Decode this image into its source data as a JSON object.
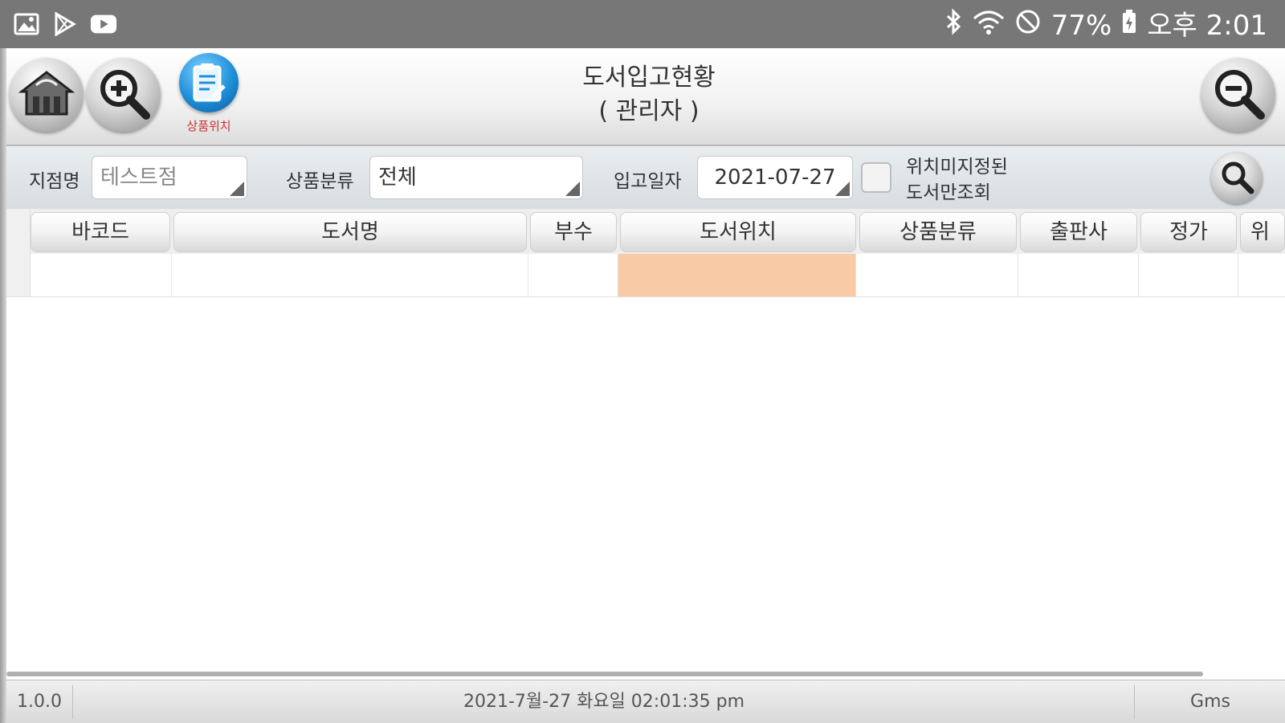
{
  "statusbar": {
    "left_icons": [
      "gallery-icon",
      "play-store-icon",
      "youtube-icon"
    ],
    "battery": "77%",
    "time": "오후 2:01"
  },
  "header": {
    "title_line1": "도서입고현황",
    "title_line2": "( 관리자 )",
    "location_button_label": "상품위치"
  },
  "filters": {
    "branch_label": "지점명",
    "branch_value": "테스트점",
    "category_label": "상품분류",
    "category_value": "전체",
    "date_label": "입고일자",
    "date_value": "2021-07-27",
    "checkbox_label_line1": "위치미지정된",
    "checkbox_label_line2": "도서만조회"
  },
  "table": {
    "columns": [
      "바코드",
      "도서명",
      "부수",
      "도서위치",
      "상품분류",
      "출판사",
      "정가",
      "위"
    ]
  },
  "footer": {
    "version": "1.0.0",
    "datetime": "2021-7월-27 화요일 02:01:35 pm",
    "company": "Gms"
  },
  "colors": {
    "status_bar": "#777777",
    "highlight_cell": "#f8cba6",
    "location_button": "#1e8fd8"
  }
}
